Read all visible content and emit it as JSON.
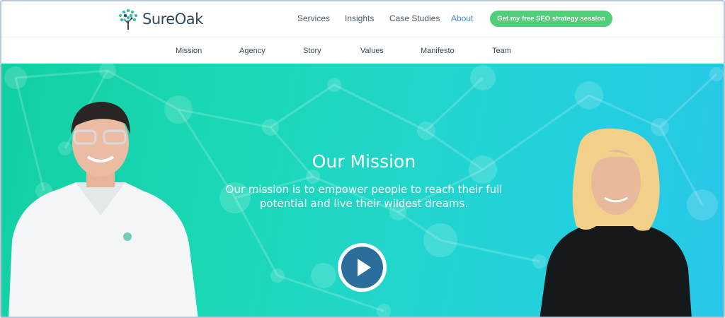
{
  "brand": {
    "name": "SureOak",
    "logo_icon": "tree-icon"
  },
  "nav": {
    "items": [
      {
        "label": "Services",
        "active": false
      },
      {
        "label": "Insights",
        "active": false
      },
      {
        "label": "Case Studies",
        "active": false
      },
      {
        "label": "About",
        "active": true
      }
    ],
    "cta_label": "Get my free SEO strategy session"
  },
  "subnav": {
    "items": [
      "Mission",
      "Agency",
      "Story",
      "Values",
      "Manifesto",
      "Team"
    ]
  },
  "hero": {
    "title": "Our Mission",
    "text": "Our mission is to empower people to reach their full potential and live their wildest dreams.",
    "play_icon": "play-icon"
  },
  "colors": {
    "cta": "#4fcf77",
    "active_link": "#3e8fd6",
    "hero_start": "#12cfa2",
    "hero_end": "#2ac6e8",
    "play": "#2b6e9b"
  }
}
